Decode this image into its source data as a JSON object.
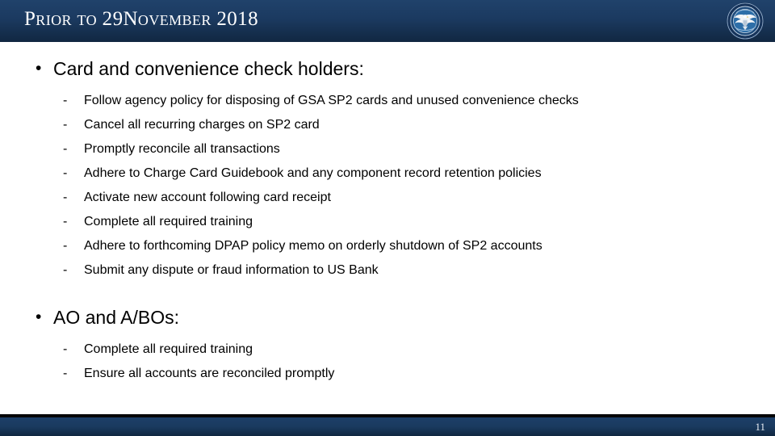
{
  "header": {
    "title": "Prior to 29November 2018",
    "logo_icon": "dod-seal-icon",
    "band_color_top": "#20426b",
    "band_color_bottom": "#112741"
  },
  "body": {
    "groups": [
      {
        "heading": "Card and convenience check holders:",
        "bullet_glyph": "•",
        "sub_glyph": "-",
        "items": [
          "Follow agency policy for disposing of GSA SP2 cards and unused convenience checks",
          "Cancel all recurring charges on SP2 card",
          "Promptly reconcile all transactions",
          "Adhere to Charge Card Guidebook and any component record retention policies",
          "Activate new account following card receipt",
          "Complete all required training",
          "Adhere to forthcoming DPAP policy memo on orderly shutdown of SP2 accounts",
          "Submit any dispute or fraud information to US Bank"
        ]
      },
      {
        "heading": "AO and A/BOs:",
        "bullet_glyph": "•",
        "sub_glyph": "-",
        "items": [
          "Complete all required training",
          "Ensure all accounts are reconciled promptly"
        ]
      }
    ]
  },
  "footer": {
    "page_number": "11",
    "band_color_top": "#1d3f68",
    "band_color_bottom": "#102740",
    "rule_color": "#060608"
  }
}
